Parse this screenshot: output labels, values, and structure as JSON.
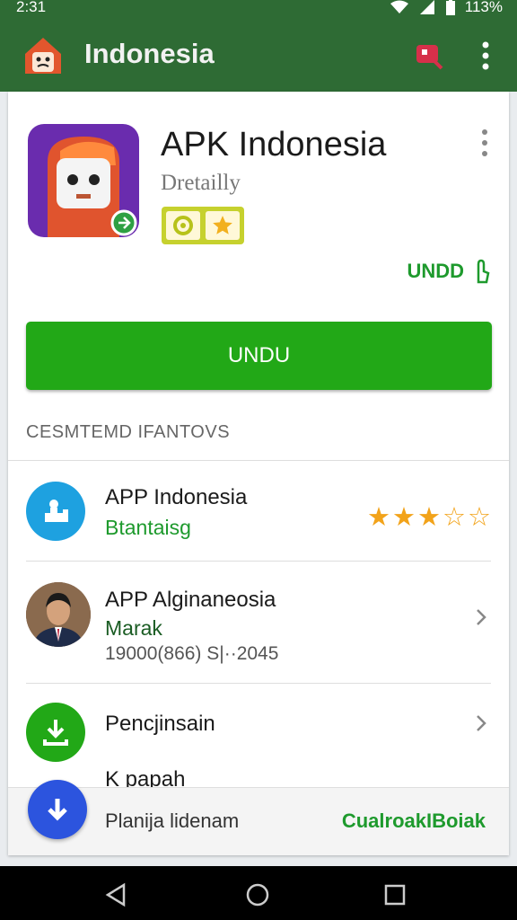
{
  "status_bar": {
    "time": "2:31",
    "battery": "113%"
  },
  "app_bar": {
    "title": "Indonesia"
  },
  "app": {
    "name": "APK Indonesia",
    "subtitle": "Dretailly",
    "download_link": "UNDD"
  },
  "primary_button": {
    "label": "UNDU"
  },
  "section": {
    "title": "CESMTEMD IFANTOVS"
  },
  "rows": [
    {
      "title": "APP Indonesia",
      "subtitle": "Btantaisg",
      "rating": 3.5
    },
    {
      "title": "APP Alginaneosia",
      "subtitle": "Marak",
      "meta": "19000(866) S|··2045"
    },
    {
      "title": "Pencjinsain",
      "subtitle": "K papah"
    }
  ],
  "footer": {
    "label": "Planija lidenam",
    "link": "CualroakIBoiak"
  },
  "colors": {
    "primary": "#2e6b34",
    "accent": "#22a817",
    "star": "#f2a31a"
  },
  "icons": {
    "app_bar": [
      "house-mascot-icon",
      "tag-icon",
      "more-vert-icon"
    ],
    "rows": [
      "info-icon",
      "profile-avatar",
      "download-icon",
      "download-arrow-icon"
    ],
    "nav": [
      "back-icon",
      "home-icon",
      "recents-icon"
    ]
  }
}
